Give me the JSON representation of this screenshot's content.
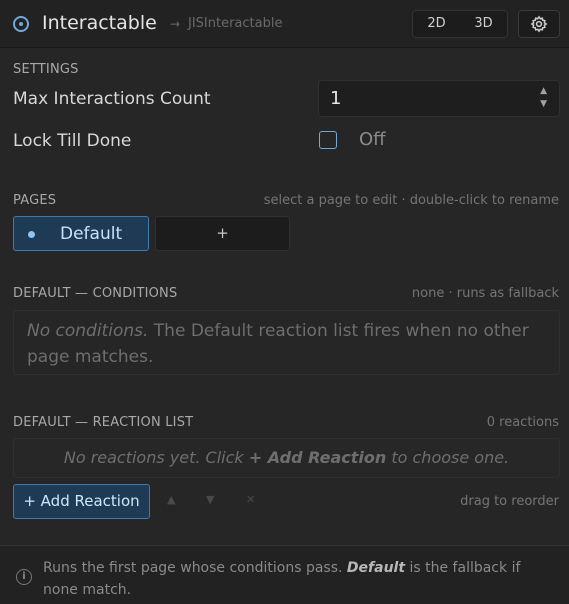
{
  "header": {
    "title": "Interactable",
    "arrow": "→",
    "subtitle": "JISInteractable",
    "view_modes": [
      "2D",
      "3D"
    ]
  },
  "settings": {
    "section_label": "SETTINGS",
    "max_label": "Max Interactions Count",
    "max_value": "1",
    "lock_label": "Lock Till Done",
    "lock_checked": false,
    "lock_state_text": "Off"
  },
  "pages": {
    "section_label": "PAGES",
    "hint": "select a page to edit · double-click to rename",
    "items": [
      "Default"
    ],
    "add_label": "+"
  },
  "conditions": {
    "section_label": "DEFAULT — CONDITIONS",
    "hint": "none · runs as fallback",
    "empty_emphasis": "No conditions.",
    "empty_text": " The Default reaction list fires when no other page matches."
  },
  "reactions": {
    "section_label": "DEFAULT — REACTION LIST",
    "count_text": "0 reactions",
    "empty_prefix": "No reactions yet. Click ",
    "empty_bold": "+ Add Reaction",
    "empty_suffix": " to choose one.",
    "add_button_label": "+ Add Reaction",
    "move_up": "▲",
    "move_down": "▼",
    "delete": "✕",
    "reorder_hint": "drag to reorder"
  },
  "footer": {
    "info_glyph": "i",
    "text_before": "Runs the first page whose conditions pass. ",
    "text_emphasis": "Default",
    "text_after": " is the fallback if none match."
  },
  "colors": {
    "accent": "#6fa8dc",
    "accent_bg": "#1f3a55",
    "panel": "#262626"
  }
}
